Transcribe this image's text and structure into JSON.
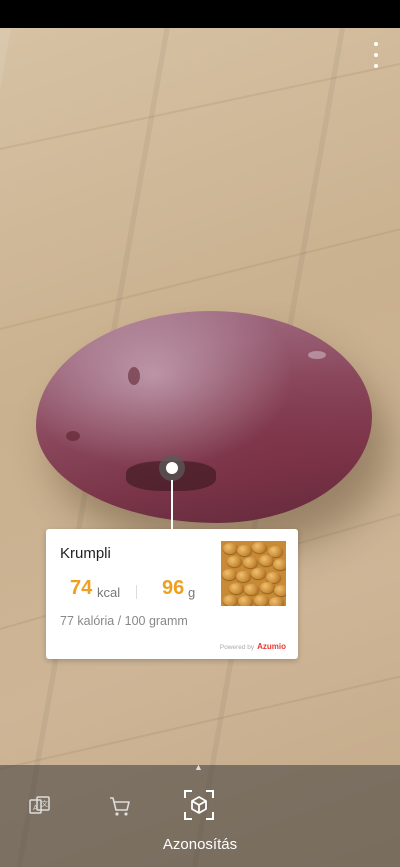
{
  "result": {
    "name": "Krumpli",
    "kcal_value": "74",
    "kcal_unit": "kcal",
    "gram_value": "96",
    "gram_unit": "g",
    "calorie_note": "77 kalória / 100 gramm",
    "powered_by": "Powered by",
    "brand": "Azumio"
  },
  "bottom_bar": {
    "active_mode_label": "Azonosítás",
    "icons": [
      "translate-icon",
      "shopping-cart-icon",
      "identify-icon"
    ]
  },
  "colors": {
    "accent": "#f0a020",
    "brand": "#e53935"
  }
}
